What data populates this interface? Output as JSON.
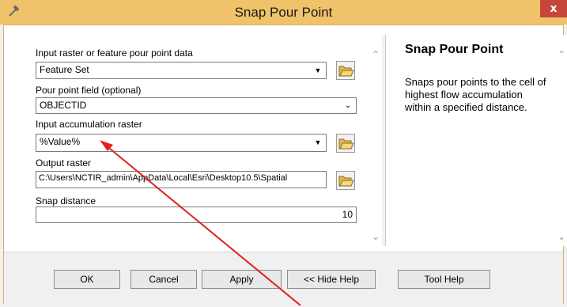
{
  "window": {
    "title": "Snap Pour Point",
    "close_label": "x"
  },
  "parameters": {
    "input_pour_point": {
      "label": "Input raster or feature pour point data",
      "value": "Feature Set"
    },
    "pour_point_field": {
      "label": "Pour point field (optional)",
      "value": "OBJECTID"
    },
    "accumulation_raster": {
      "label": "Input accumulation raster",
      "value": "%Value%"
    },
    "output_raster": {
      "label": "Output raster",
      "value": "C:\\Users\\NCTIR_admin\\AppData\\Local\\Esri\\Desktop10.5\\Spatial"
    },
    "snap_distance": {
      "label": "Snap distance",
      "value": "10"
    }
  },
  "help": {
    "title": "Snap Pour Point",
    "text": "Snaps pour points to the cell of highest flow accumulation within a specified distance."
  },
  "buttons": {
    "ok": "OK",
    "cancel": "Cancel",
    "apply": "Apply",
    "hide_help": "<< Hide Help",
    "tool_help": "Tool Help"
  },
  "colors": {
    "title_bar": "#f0c26a",
    "close_button": "#c7463a",
    "annotation_arrow": "#e02020"
  },
  "icons": {
    "app": "hammer-icon",
    "browse": "folder-open-icon",
    "dropdown": "dropdown-arrow-icon",
    "scroll_up": "chevron-up-icon",
    "scroll_down": "chevron-down-icon"
  }
}
